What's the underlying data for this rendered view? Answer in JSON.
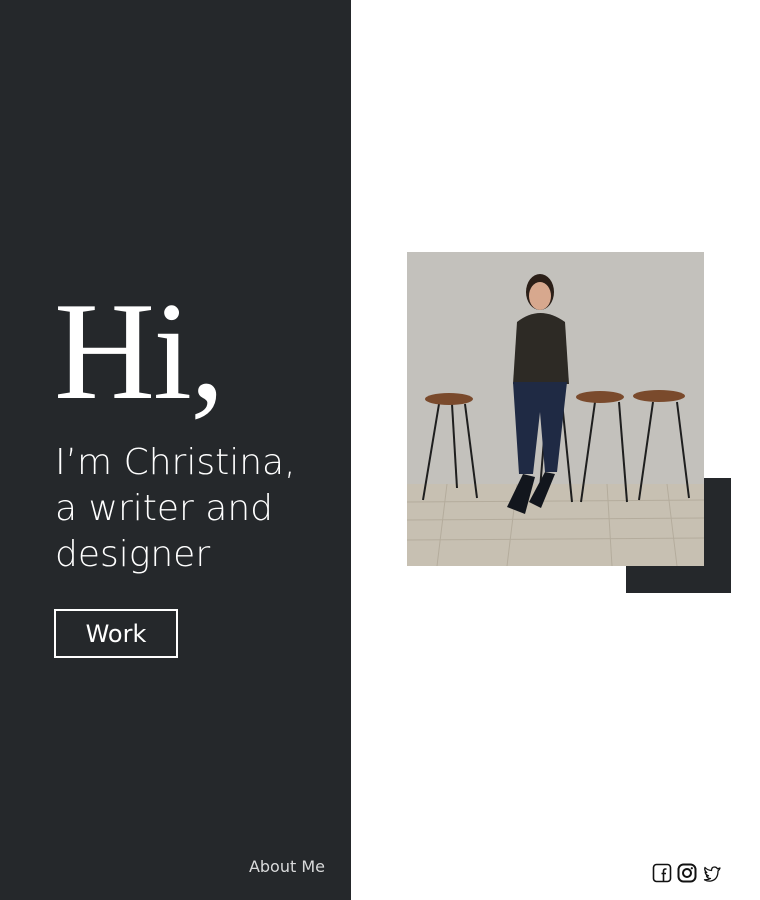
{
  "hero": {
    "greeting": "Hi,",
    "intro_lines": [
      "I’m Christina,",
      "a writer and",
      "designer"
    ]
  },
  "nav": {
    "work_label": "Work",
    "about_label": "About Me"
  },
  "social": {
    "icons": [
      "facebook-icon",
      "instagram-icon",
      "twitter-icon"
    ]
  },
  "colors": {
    "panel": "#25282b",
    "background": "#ffffff",
    "text_light": "#ffffff"
  }
}
